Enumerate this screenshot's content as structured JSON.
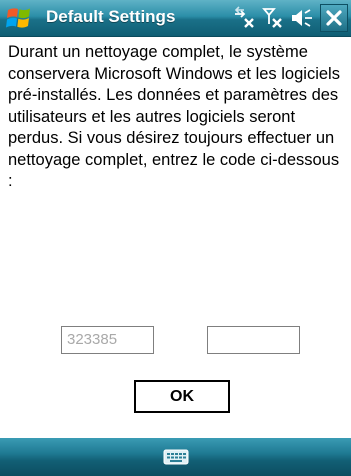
{
  "window": {
    "title": "Default Settings"
  },
  "colors": {
    "titlebar": "#2b8ea8",
    "bottombar": "#1f7a93",
    "close_button": "#1d6f86"
  },
  "icons": {
    "start": "windows-flag-icon",
    "connectivity": "connectivity-off-icon",
    "signal": "signal-off-icon",
    "volume": "volume-icon",
    "close": "close-icon",
    "keyboard": "keyboard-icon"
  },
  "dialog": {
    "message": "Durant un nettoyage complet, le système conservera Microsoft Windows et les logiciels pré-installés. Les données et paramètres des utilisateurs et les autres logiciels seront perdus. Si vous désirez toujours effectuer un nettoyage complet, entrez le code ci-dessous :",
    "code_display": "323385",
    "code_input_value": "",
    "ok_label": "OK"
  }
}
